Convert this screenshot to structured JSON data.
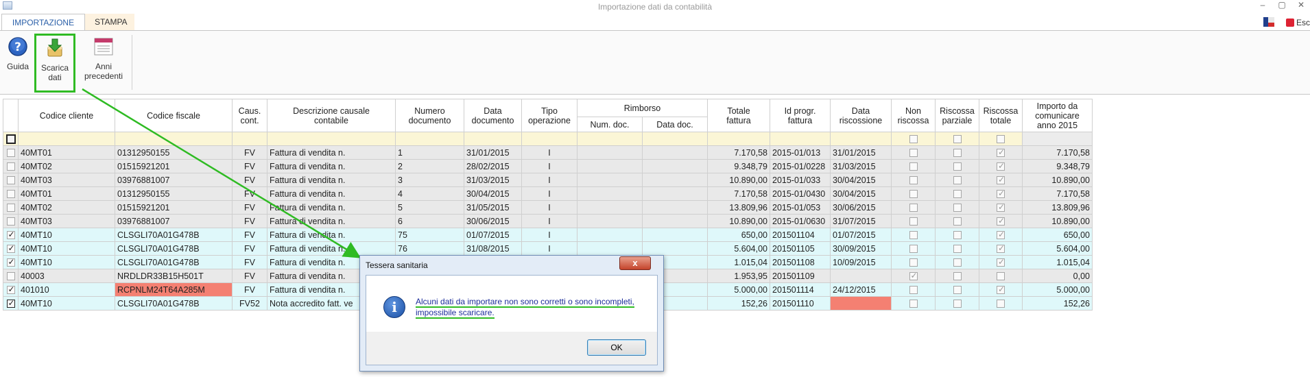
{
  "window": {
    "title": "Importazione dati da contabilità",
    "exit_label": "Esc"
  },
  "tabs": [
    {
      "label": "IMPORTAZIONE",
      "active": true
    },
    {
      "label": "STAMPA",
      "active": false
    }
  ],
  "ribbon": {
    "guida": "Guida",
    "scarica_1": "Scarica",
    "scarica_2": "dati",
    "anni_1": "Anni",
    "anni_2": "precedenti"
  },
  "columns": {
    "codice_cliente": "Codice cliente",
    "codice_fiscale": "Codice fiscale",
    "caus_1": "Caus.",
    "caus_2": "cont.",
    "descr_1": "Descrizione causale",
    "descr_2": "contabile",
    "numero_1": "Numero",
    "numero_2": "documento",
    "data_1": "Data",
    "data_2": "documento",
    "tipo_1": "Tipo",
    "tipo_2": "operazione",
    "rimborso": "Rimborso",
    "num_doc": "Num. doc.",
    "data_doc": "Data doc.",
    "totale_1": "Totale",
    "totale_2": "fattura",
    "idprogr_1": "Id progr.",
    "idprogr_2": "fattura",
    "riscossione_1": "Data",
    "riscossione_2": "riscossione",
    "non_1": "Non",
    "non_2": "riscossa",
    "parz_1": "Riscossa",
    "parz_2": "parziale",
    "tot_1": "Riscossa",
    "tot_2": "totale",
    "importo_1": "Importo da",
    "importo_2": "comunicare",
    "importo_3": "anno 2015"
  },
  "rows": [
    {
      "sel": false,
      "style": "gray",
      "cliente": "40MT01",
      "cf": "01312950155",
      "caus": "FV",
      "descr": "Fattura di vendita n.",
      "num": "1",
      "data": "31/01/2015",
      "tipo": "I",
      "totale": "7.170,58",
      "id": "2015-01/013",
      "risc": "31/01/2015",
      "non": false,
      "parz": false,
      "tot": true,
      "importo": "7.170,58"
    },
    {
      "sel": false,
      "style": "gray",
      "cliente": "40MT02",
      "cf": "01515921201",
      "caus": "FV",
      "descr": "Fattura di vendita n.",
      "num": "2",
      "data": "28/02/2015",
      "tipo": "I",
      "totale": "9.348,79",
      "id": "2015-01/0228",
      "risc": "31/03/2015",
      "non": false,
      "parz": false,
      "tot": true,
      "importo": "9.348,79"
    },
    {
      "sel": false,
      "style": "gray",
      "cliente": "40MT03",
      "cf": "03976881007",
      "caus": "FV",
      "descr": "Fattura di vendita n.",
      "num": "3",
      "data": "31/03/2015",
      "tipo": "I",
      "totale": "10.890,00",
      "id": "2015-01/033",
      "risc": "30/04/2015",
      "non": false,
      "parz": false,
      "tot": true,
      "importo": "10.890,00"
    },
    {
      "sel": false,
      "style": "gray",
      "cliente": "40MT01",
      "cf": "01312950155",
      "caus": "FV",
      "descr": "Fattura di vendita n.",
      "num": "4",
      "data": "30/04/2015",
      "tipo": "I",
      "totale": "7.170,58",
      "id": "2015-01/0430",
      "risc": "30/04/2015",
      "non": false,
      "parz": false,
      "tot": true,
      "importo": "7.170,58"
    },
    {
      "sel": false,
      "style": "gray",
      "cliente": "40MT02",
      "cf": "01515921201",
      "caus": "FV",
      "descr": "Fattura di vendita n.",
      "num": "5",
      "data": "31/05/2015",
      "tipo": "I",
      "totale": "13.809,96",
      "id": "2015-01/053",
      "risc": "30/06/2015",
      "non": false,
      "parz": false,
      "tot": true,
      "importo": "13.809,96"
    },
    {
      "sel": false,
      "style": "gray",
      "cliente": "40MT03",
      "cf": "03976881007",
      "caus": "FV",
      "descr": "Fattura di vendita n.",
      "num": "6",
      "data": "30/06/2015",
      "tipo": "I",
      "totale": "10.890,00",
      "id": "2015-01/0630",
      "risc": "31/07/2015",
      "non": false,
      "parz": false,
      "tot": true,
      "importo": "10.890,00"
    },
    {
      "sel": true,
      "style": "cyan",
      "cliente": "40MT10",
      "cf": "CLSGLI70A01G478B",
      "caus": "FV",
      "descr": "Fattura di vendita n.",
      "num": "75",
      "data": "01/07/2015",
      "tipo": "I",
      "totale": "650,00",
      "id": "201501104",
      "risc": "01/07/2015",
      "non": false,
      "parz": false,
      "tot": true,
      "importo": "650,00"
    },
    {
      "sel": true,
      "style": "cyan",
      "cliente": "40MT10",
      "cf": "CLSGLI70A01G478B",
      "caus": "FV",
      "descr": "Fattura di vendita n.",
      "num": "76",
      "data": "31/08/2015",
      "tipo": "I",
      "totale": "5.604,00",
      "id": "201501105",
      "risc": "30/09/2015",
      "non": false,
      "parz": false,
      "tot": true,
      "importo": "5.604,00"
    },
    {
      "sel": true,
      "style": "cyan",
      "cliente": "40MT10",
      "cf": "CLSGLI70A01G478B",
      "caus": "FV",
      "descr": "Fattura di vendita n.",
      "num": "",
      "data": "",
      "tipo": "",
      "totale": "1.015,04",
      "id": "201501108",
      "risc": "10/09/2015",
      "non": false,
      "parz": false,
      "tot": true,
      "importo": "1.015,04"
    },
    {
      "sel": false,
      "style": "gray",
      "cliente": "40003",
      "cf": "NRDLDR33B15H501T",
      "caus": "FV",
      "descr": "Fattura di vendita n.",
      "num": "",
      "data": "",
      "tipo": "",
      "totale": "1.953,95",
      "id": "201501109",
      "risc": "",
      "non": true,
      "parz": false,
      "tot": false,
      "importo": "0,00"
    },
    {
      "sel": true,
      "style": "cyan",
      "cliente": "401010",
      "cf": "RCPNLM24T64A285M",
      "cfRed": true,
      "caus": "FV",
      "descr": "Fattura di vendita n.",
      "num": "",
      "data": "",
      "tipo": "",
      "totale": "5.000,00",
      "id": "201501114",
      "risc": "24/12/2015",
      "non": false,
      "parz": false,
      "tot": true,
      "importo": "5.000,00"
    },
    {
      "sel": true,
      "style": "cyan",
      "cliente": "40MT10",
      "cf": "CLSGLI70A01G478B",
      "caus": "FV52",
      "descr": "Nota accredito fatt. ve",
      "num": "",
      "data": "",
      "tipo": "",
      "totale": "152,26",
      "id": "201501110",
      "risc": "",
      "riscRed": true,
      "non": false,
      "parz": false,
      "tot": false,
      "importo": "152,26"
    }
  ],
  "dialog": {
    "title": "Tessera sanitaria",
    "close": "x",
    "line1": "Alcuni dati da importare non sono corretti o sono incompleti,",
    "line2": "impossibile scaricare.",
    "ok": "OK"
  },
  "colors": {
    "highlight": "#2fbb23",
    "error_cell": "#f48072",
    "row_cyan": "#dff8fa",
    "row_gray": "#e9e9e9"
  }
}
